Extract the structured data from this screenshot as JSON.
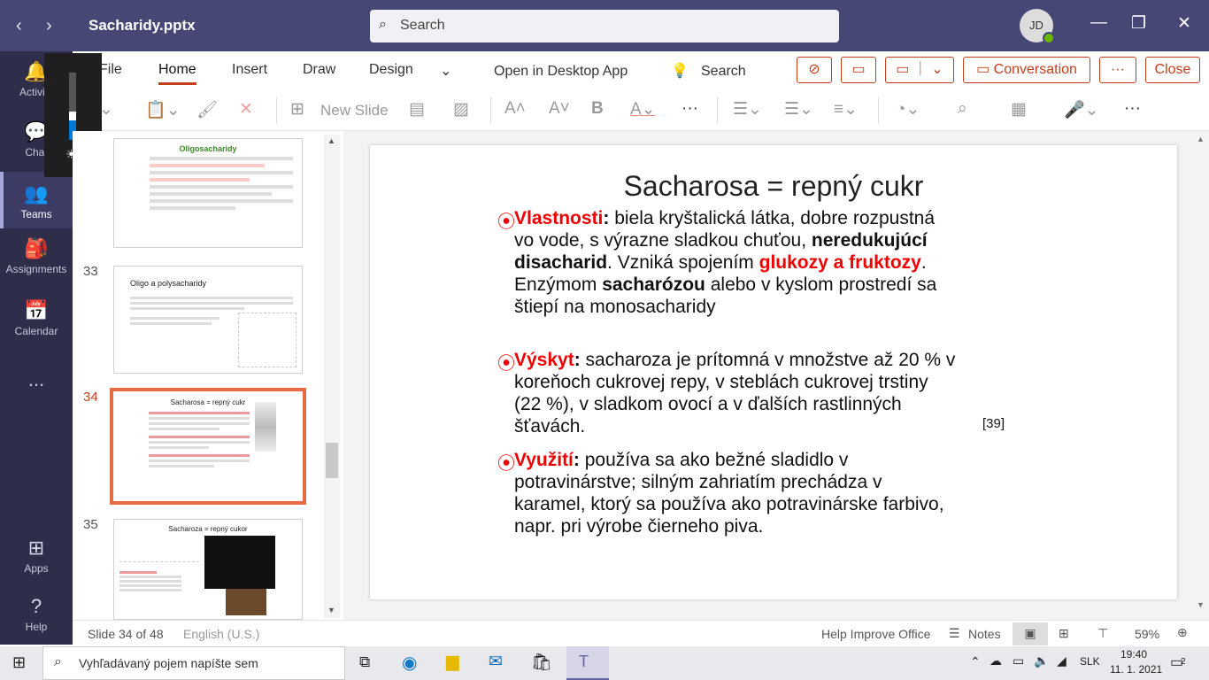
{
  "titlebar": {
    "file_name": "Sacharidy.pptx",
    "search_placeholder": "Search",
    "avatar_initials": "JD"
  },
  "rail": {
    "items": [
      {
        "label": "Activity"
      },
      {
        "label": "Chat"
      },
      {
        "label": "Teams"
      },
      {
        "label": "Assignments"
      },
      {
        "label": "Calendar"
      },
      {
        "label": "..."
      },
      {
        "label": "Apps"
      },
      {
        "label": "Help"
      }
    ]
  },
  "ribbon": {
    "tabs": [
      "File",
      "Home",
      "Insert",
      "Draw",
      "Design"
    ],
    "open_desktop": "Open in Desktop App",
    "search": "Search",
    "conversation": "Conversation",
    "more": "···",
    "close": "Close"
  },
  "toolbar": {
    "new_slide": "New Slide"
  },
  "thumbs": {
    "t32": {
      "title": "Oligosacharidy"
    },
    "t33": {
      "num": "33",
      "title": "Oligo a polysacharidy"
    },
    "t34": {
      "num": "34",
      "title": "Sacharosa = repný cukr"
    },
    "t35": {
      "num": "35",
      "title": "Sacharoza = repný cukor"
    }
  },
  "slide": {
    "title": "Sacharosa = repný cukr",
    "p1": {
      "label": "Vlastnosti",
      "colon": ":",
      "t1": " biela kryštalická látka, dobre rozpustná vo vode, s výrazne sladkou chuťou, ",
      "bold1": "neredukujúcí disacharid",
      "t2": ". Vzniká spojením ",
      "red1": "glukozy a fruktozy",
      "t3": ". Enzýmom ",
      "bold2": "sacharózou",
      "t4": " alebo   v kyslom prostredí sa štiepí na monosacharidy"
    },
    "p2": {
      "label": "Výskyt",
      "colon": ":",
      "text": " sacharoza je prítomná v množstve až 20 % v koreňoch cukrovej repy, v steblách cukrovej trstiny (22 %), v sladkom ovocí a v ďalších rastlinných šťavách."
    },
    "p3": {
      "label": "Využití",
      "colon": ":",
      "text": " používa sa ako bežné sladidlo v potravinárstve; silným zahriatím prechádza v karamel, ktorý sa používa ako potravinárske farbivo, napr. pri výrobe čierneho piva."
    },
    "ref": "[39]"
  },
  "status": {
    "slide_info": "Slide 34 of 48",
    "language": "English (U.S.)",
    "help": "Help Improve Office",
    "notes": "Notes",
    "zoom": "59%"
  },
  "taskbar": {
    "search": "Vyhľadávaný pojem napíšte sem",
    "lang": "SLK",
    "time": "19:40",
    "date": "11. 1. 2021",
    "notif": "2"
  }
}
